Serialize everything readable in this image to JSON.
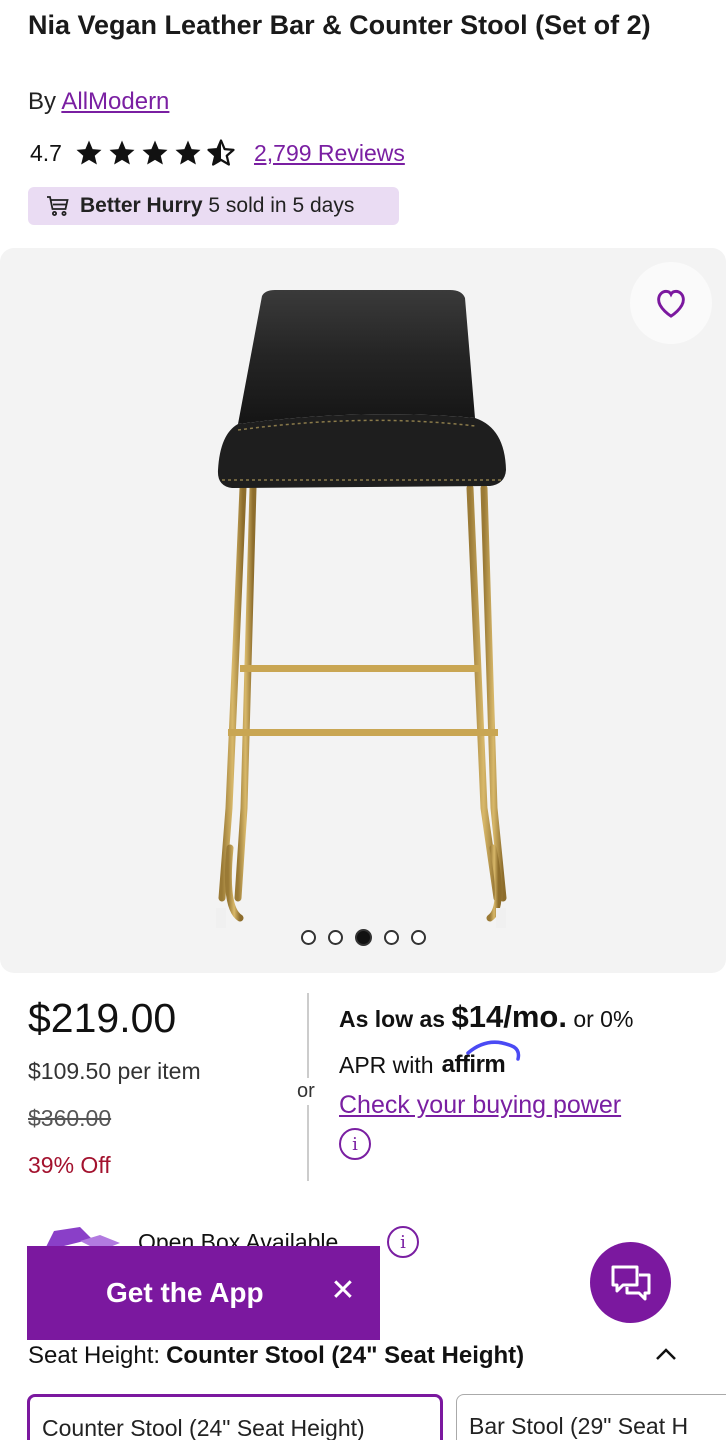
{
  "product": {
    "title": "Nia Vegan Leather Bar & Counter Stool (Set of 2)",
    "by_label": "By",
    "brand": "AllModern",
    "rating": "4.7",
    "stars_filled": 4.5,
    "reviews": "2,799 Reviews"
  },
  "hurry": {
    "bold": "Better Hurry",
    "text": "5 sold in 5 days",
    "icon": "cart-icon"
  },
  "gallery": {
    "image_count": 5,
    "active_index": 2,
    "favorite_icon": "heart-icon"
  },
  "pricing": {
    "price": "$219.00",
    "per_item": "$109.50 per item",
    "original_price": "$360.00",
    "discount": "39% Off",
    "or_label": "or"
  },
  "financing": {
    "as_low_as": "As low as",
    "monthly": "$14/mo.",
    "suffix": "or 0%",
    "apr_text": "APR with",
    "affirm": "affirm",
    "buying_power": "Check your buying power",
    "info_glyph": "i"
  },
  "open_box": {
    "label": "Open Box Available",
    "info_glyph": "i"
  },
  "app_banner": {
    "label": "Get the App",
    "close_glyph": "✕"
  },
  "chat": {
    "icon": "chat-icon"
  },
  "seat_height": {
    "label": "Seat Height:",
    "value": "Counter Stool (24\" Seat Height)",
    "options": [
      "Counter Stool (24\" Seat Height)",
      "Bar Stool (29\" Seat H"
    ]
  },
  "colors": {
    "accent": "#7b189f",
    "hurry_bg": "#eadcf3",
    "discount": "#a3122e"
  }
}
